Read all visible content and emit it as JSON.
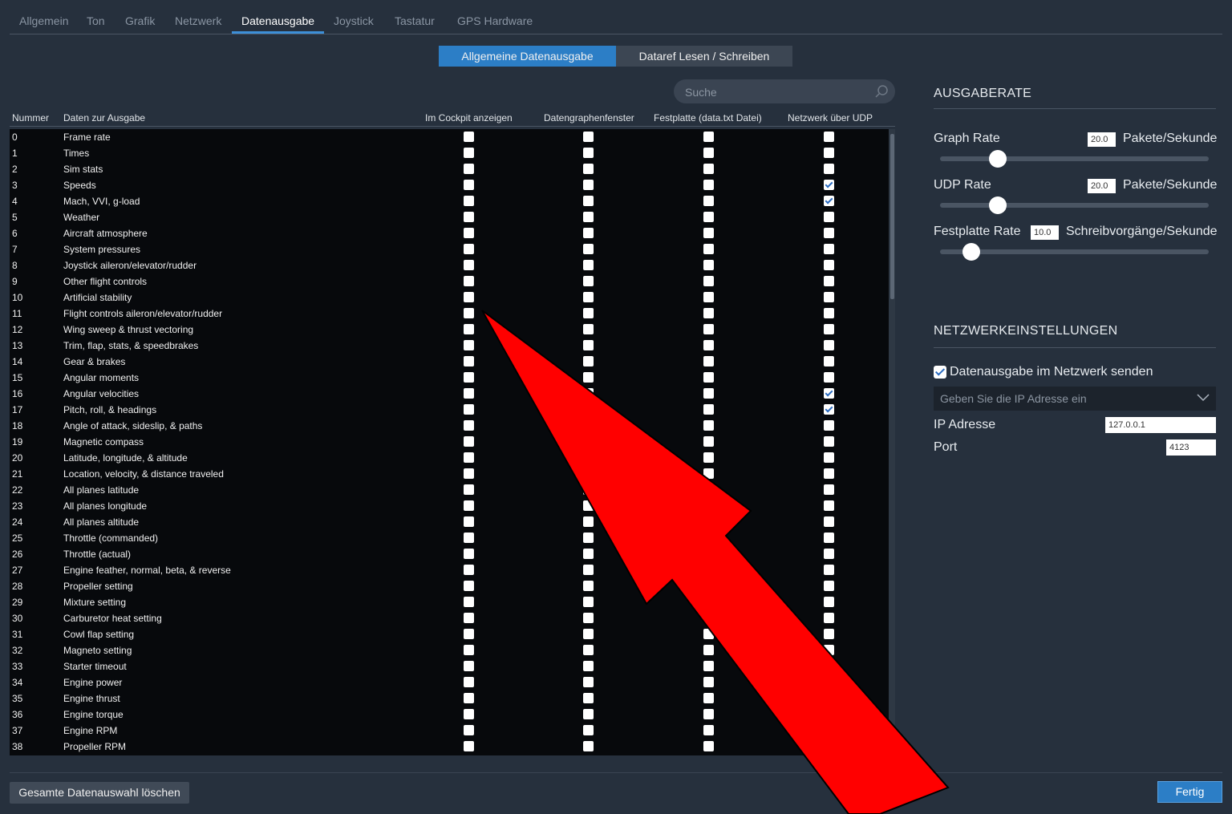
{
  "tabs": [
    "Allgemein",
    "Ton",
    "Grafik",
    "Netzwerk",
    "Datenausgabe",
    "Joystick",
    "Tastatur",
    "GPS Hardware"
  ],
  "active_tab": "Datenausgabe",
  "segments": [
    "Allgemeine Datenausgabe",
    "Dataref Lesen / Schreiben"
  ],
  "search": {
    "placeholder": "Suche"
  },
  "table": {
    "headers": [
      "Nummer",
      "Daten zur Ausgabe",
      "Im Cockpit anzeigen",
      "Datengraphenfenster",
      "Festplatte (data.txt Datei)",
      "Netzwerk über UDP"
    ],
    "rows": [
      {
        "num": "0",
        "name": "Frame rate",
        "udp": false
      },
      {
        "num": "1",
        "name": "Times",
        "udp": false
      },
      {
        "num": "2",
        "name": "Sim stats",
        "udp": false
      },
      {
        "num": "3",
        "name": "Speeds",
        "udp": true
      },
      {
        "num": "4",
        "name": "Mach, VVI, g-load",
        "udp": true
      },
      {
        "num": "5",
        "name": "Weather",
        "udp": false
      },
      {
        "num": "6",
        "name": "Aircraft atmosphere",
        "udp": false
      },
      {
        "num": "7",
        "name": "System pressures",
        "udp": false
      },
      {
        "num": "8",
        "name": "Joystick aileron/elevator/rudder",
        "udp": false
      },
      {
        "num": "9",
        "name": "Other flight controls",
        "udp": false
      },
      {
        "num": "10",
        "name": "Artificial stability",
        "udp": false
      },
      {
        "num": "11",
        "name": "Flight controls aileron/elevator/rudder",
        "udp": false
      },
      {
        "num": "12",
        "name": "Wing sweep & thrust vectoring",
        "udp": false
      },
      {
        "num": "13",
        "name": "Trim, flap, stats, & speedbrakes",
        "udp": false
      },
      {
        "num": "14",
        "name": "Gear & brakes",
        "udp": false
      },
      {
        "num": "15",
        "name": "Angular moments",
        "udp": false
      },
      {
        "num": "16",
        "name": "Angular velocities",
        "udp": true
      },
      {
        "num": "17",
        "name": "Pitch, roll, & headings",
        "udp": true
      },
      {
        "num": "18",
        "name": "Angle of attack, sideslip, & paths",
        "udp": false
      },
      {
        "num": "19",
        "name": "Magnetic compass",
        "udp": false
      },
      {
        "num": "20",
        "name": "Latitude, longitude, & altitude",
        "udp": false
      },
      {
        "num": "21",
        "name": "Location, velocity, & distance traveled",
        "udp": false
      },
      {
        "num": "22",
        "name": "All planes latitude",
        "udp": false
      },
      {
        "num": "23",
        "name": "All planes longitude",
        "udp": false
      },
      {
        "num": "24",
        "name": "All planes altitude",
        "udp": false
      },
      {
        "num": "25",
        "name": "Throttle (commanded)",
        "udp": false
      },
      {
        "num": "26",
        "name": "Throttle (actual)",
        "udp": false
      },
      {
        "num": "27",
        "name": "Engine feather, normal, beta, & reverse",
        "udp": false
      },
      {
        "num": "28",
        "name": "Propeller setting",
        "udp": false
      },
      {
        "num": "29",
        "name": "Mixture setting",
        "udp": false
      },
      {
        "num": "30",
        "name": "Carburetor heat setting",
        "udp": false
      },
      {
        "num": "31",
        "name": "Cowl flap setting",
        "udp": false
      },
      {
        "num": "32",
        "name": "Magneto setting",
        "udp": false
      },
      {
        "num": "33",
        "name": "Starter timeout",
        "udp": false
      },
      {
        "num": "34",
        "name": "Engine power",
        "udp": false
      },
      {
        "num": "35",
        "name": "Engine thrust",
        "udp": false
      },
      {
        "num": "36",
        "name": "Engine torque",
        "udp": false
      },
      {
        "num": "37",
        "name": "Engine RPM",
        "udp": false
      },
      {
        "num": "38",
        "name": "Propeller RPM",
        "udp": false
      }
    ]
  },
  "output_rate": {
    "title": "AUSGABERATE",
    "graph": {
      "label": "Graph Rate",
      "value": "20.0",
      "unit": "Pakete/Sekunde",
      "level": 0.2
    },
    "udp": {
      "label": "UDP Rate",
      "value": "20.0",
      "unit": "Pakete/Sekunde",
      "level": 0.2
    },
    "disk": {
      "label": "Festplatte Rate",
      "value": "10.0",
      "unit": "Schreibvorgänge/Sekunde",
      "level": 0.1
    }
  },
  "network": {
    "title": "NETZWERKEINSTELLUNGEN",
    "send_label": "Datenausgabe im Netzwerk senden",
    "send_checked": true,
    "ip_placeholder": "Geben Sie die IP Adresse ein",
    "ip_label": "IP Adresse",
    "ip_value": "127.0.0.1",
    "port_label": "Port",
    "port_value": "4123"
  },
  "buttons": {
    "clear": "Gesamte Datenauswahl löschen",
    "done": "Fertig"
  },
  "colors": {
    "accent": "#2c7ec6",
    "background": "#26303d",
    "arrow": "#ff0000"
  }
}
